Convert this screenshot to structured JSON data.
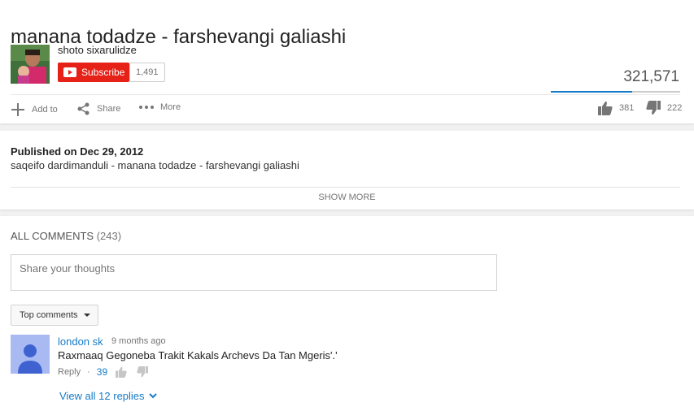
{
  "video": {
    "title": "manana todadze - farshevangi galiashi",
    "views": "321,571",
    "views_ratio": 0.63,
    "likes": "381",
    "dislikes": "222"
  },
  "channel": {
    "name": "shoto sixarulidze",
    "subscribe_label": "Subscribe",
    "subscriber_count": "1,491"
  },
  "actions": {
    "add_to": "Add to",
    "share": "Share",
    "more": "More"
  },
  "description": {
    "published": "Published on Dec 29, 2012",
    "text": "saqeifo dardimanduli - manana todadze - farshevangi galiashi",
    "show_more": "SHOW MORE"
  },
  "comments": {
    "header": "ALL COMMENTS",
    "count": "(243)",
    "placeholder": "Share your thoughts",
    "sort_label": "Top comments",
    "items": [
      {
        "author": "london sk",
        "time": "9 months ago",
        "text": "Raxmaaq Gegoneba Trakit Kakals Archevs Da Tan Mgeris'.'",
        "reply_label": "Reply",
        "separator": "·",
        "score": "39",
        "view_replies": "View all 12 replies"
      }
    ]
  },
  "colors": {
    "accent": "#167ac6",
    "subscribe": "#e62117"
  }
}
